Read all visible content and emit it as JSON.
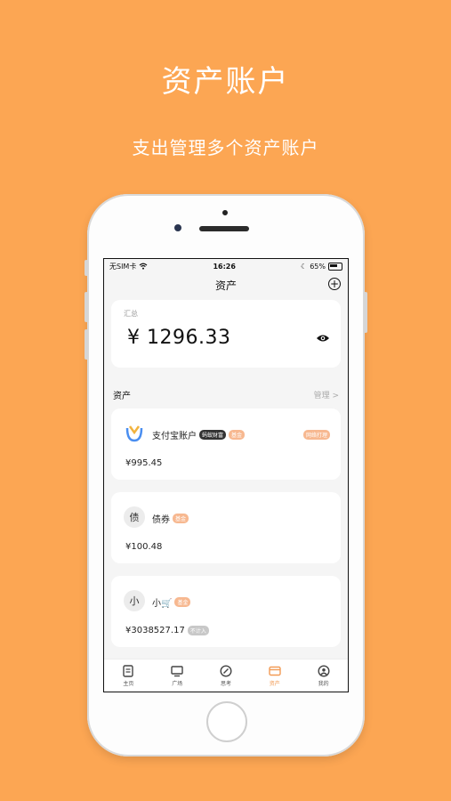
{
  "promo": {
    "headline": "资产账户",
    "subline": "支出管理多个资产账户"
  },
  "status_bar": {
    "carrier": "无SIM卡",
    "time": "16:26",
    "battery": "65%"
  },
  "nav": {
    "title": "资产",
    "add_icon": "plus-circle-icon"
  },
  "summary": {
    "label": "汇总",
    "amount": "¥ 1296.33",
    "visibility_icon": "eye-icon"
  },
  "assets_section": {
    "title": "资产",
    "manage_label": "管理 >"
  },
  "assets": [
    {
      "icon_text": "",
      "icon": "alipay-logo-icon",
      "name": "支付宝账户",
      "badge": "蚂蚁财富",
      "tag": "基金",
      "right_tag": "网络打理",
      "amount": "¥995.45"
    },
    {
      "icon_text": "债",
      "name": "债券",
      "tag": "基金",
      "amount": "¥100.48"
    },
    {
      "icon_text": "小",
      "name": "小🛒",
      "tag": "基金",
      "amount": "¥3038527.17",
      "amount_tag": "不计入"
    }
  ],
  "tabbar": [
    {
      "label": "主页",
      "icon": "document-icon"
    },
    {
      "label": "广场",
      "icon": "monitor-icon"
    },
    {
      "label": "思考",
      "icon": "compass-icon"
    },
    {
      "label": "资产",
      "icon": "card-icon",
      "active": true
    },
    {
      "label": "我的",
      "icon": "user-icon"
    }
  ],
  "colors": {
    "background": "#FCA653",
    "accent": "#F29B55"
  }
}
